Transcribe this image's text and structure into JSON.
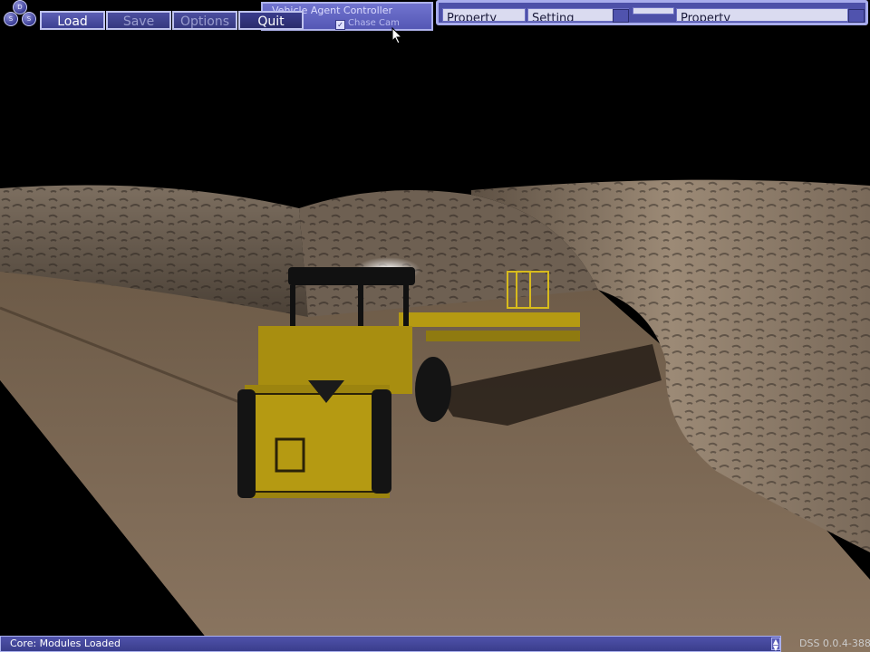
{
  "logo": {
    "letters": [
      "D",
      "S",
      "S"
    ]
  },
  "toolbar": {
    "load_label": "Load",
    "save_label": "Save",
    "options_label": "Options",
    "quit_label": "Quit"
  },
  "agent_panel": {
    "title": "Vehicle Agent Controller",
    "chase_cam_label": "Chase Cam",
    "chase_cam_checked": true
  },
  "property_panel": {
    "col1_header": "Property",
    "col2_header": "Setting",
    "col3_header": "Property"
  },
  "status_bar": {
    "message": "Core: Modules Loaded"
  },
  "version": "DSS 0.0.4-388",
  "scene": {
    "description_icon": "mine-tunnel-scene",
    "vehicle_icon": "loader-vehicle",
    "colors": {
      "vehicle": "#b59a12",
      "rock": "#8a7a68",
      "floor": "#6f5c48",
      "sky": "#000000"
    }
  }
}
